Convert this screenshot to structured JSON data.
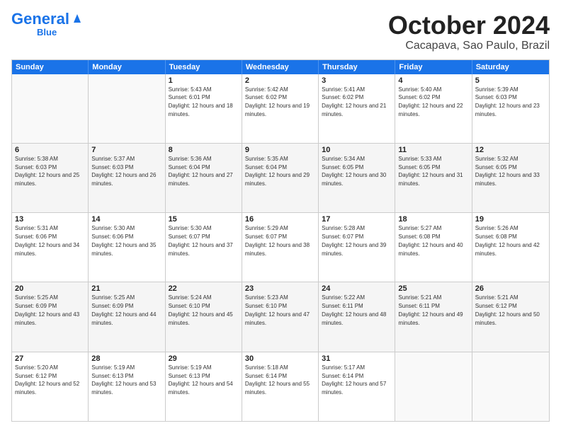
{
  "logo": {
    "part1": "General",
    "part2": "Blue"
  },
  "title": "October 2024",
  "subtitle": "Cacapava, Sao Paulo, Brazil",
  "days": [
    "Sunday",
    "Monday",
    "Tuesday",
    "Wednesday",
    "Thursday",
    "Friday",
    "Saturday"
  ],
  "weeks": [
    [
      {
        "day": "",
        "info": ""
      },
      {
        "day": "",
        "info": ""
      },
      {
        "day": "1",
        "info": "Sunrise: 5:43 AM\nSunset: 6:01 PM\nDaylight: 12 hours and 18 minutes."
      },
      {
        "day": "2",
        "info": "Sunrise: 5:42 AM\nSunset: 6:02 PM\nDaylight: 12 hours and 19 minutes."
      },
      {
        "day": "3",
        "info": "Sunrise: 5:41 AM\nSunset: 6:02 PM\nDaylight: 12 hours and 21 minutes."
      },
      {
        "day": "4",
        "info": "Sunrise: 5:40 AM\nSunset: 6:02 PM\nDaylight: 12 hours and 22 minutes."
      },
      {
        "day": "5",
        "info": "Sunrise: 5:39 AM\nSunset: 6:03 PM\nDaylight: 12 hours and 23 minutes."
      }
    ],
    [
      {
        "day": "6",
        "info": "Sunrise: 5:38 AM\nSunset: 6:03 PM\nDaylight: 12 hours and 25 minutes."
      },
      {
        "day": "7",
        "info": "Sunrise: 5:37 AM\nSunset: 6:03 PM\nDaylight: 12 hours and 26 minutes."
      },
      {
        "day": "8",
        "info": "Sunrise: 5:36 AM\nSunset: 6:04 PM\nDaylight: 12 hours and 27 minutes."
      },
      {
        "day": "9",
        "info": "Sunrise: 5:35 AM\nSunset: 6:04 PM\nDaylight: 12 hours and 29 minutes."
      },
      {
        "day": "10",
        "info": "Sunrise: 5:34 AM\nSunset: 6:05 PM\nDaylight: 12 hours and 30 minutes."
      },
      {
        "day": "11",
        "info": "Sunrise: 5:33 AM\nSunset: 6:05 PM\nDaylight: 12 hours and 31 minutes."
      },
      {
        "day": "12",
        "info": "Sunrise: 5:32 AM\nSunset: 6:05 PM\nDaylight: 12 hours and 33 minutes."
      }
    ],
    [
      {
        "day": "13",
        "info": "Sunrise: 5:31 AM\nSunset: 6:06 PM\nDaylight: 12 hours and 34 minutes."
      },
      {
        "day": "14",
        "info": "Sunrise: 5:30 AM\nSunset: 6:06 PM\nDaylight: 12 hours and 35 minutes."
      },
      {
        "day": "15",
        "info": "Sunrise: 5:30 AM\nSunset: 6:07 PM\nDaylight: 12 hours and 37 minutes."
      },
      {
        "day": "16",
        "info": "Sunrise: 5:29 AM\nSunset: 6:07 PM\nDaylight: 12 hours and 38 minutes."
      },
      {
        "day": "17",
        "info": "Sunrise: 5:28 AM\nSunset: 6:07 PM\nDaylight: 12 hours and 39 minutes."
      },
      {
        "day": "18",
        "info": "Sunrise: 5:27 AM\nSunset: 6:08 PM\nDaylight: 12 hours and 40 minutes."
      },
      {
        "day": "19",
        "info": "Sunrise: 5:26 AM\nSunset: 6:08 PM\nDaylight: 12 hours and 42 minutes."
      }
    ],
    [
      {
        "day": "20",
        "info": "Sunrise: 5:25 AM\nSunset: 6:09 PM\nDaylight: 12 hours and 43 minutes."
      },
      {
        "day": "21",
        "info": "Sunrise: 5:25 AM\nSunset: 6:09 PM\nDaylight: 12 hours and 44 minutes."
      },
      {
        "day": "22",
        "info": "Sunrise: 5:24 AM\nSunset: 6:10 PM\nDaylight: 12 hours and 45 minutes."
      },
      {
        "day": "23",
        "info": "Sunrise: 5:23 AM\nSunset: 6:10 PM\nDaylight: 12 hours and 47 minutes."
      },
      {
        "day": "24",
        "info": "Sunrise: 5:22 AM\nSunset: 6:11 PM\nDaylight: 12 hours and 48 minutes."
      },
      {
        "day": "25",
        "info": "Sunrise: 5:21 AM\nSunset: 6:11 PM\nDaylight: 12 hours and 49 minutes."
      },
      {
        "day": "26",
        "info": "Sunrise: 5:21 AM\nSunset: 6:12 PM\nDaylight: 12 hours and 50 minutes."
      }
    ],
    [
      {
        "day": "27",
        "info": "Sunrise: 5:20 AM\nSunset: 6:12 PM\nDaylight: 12 hours and 52 minutes."
      },
      {
        "day": "28",
        "info": "Sunrise: 5:19 AM\nSunset: 6:13 PM\nDaylight: 12 hours and 53 minutes."
      },
      {
        "day": "29",
        "info": "Sunrise: 5:19 AM\nSunset: 6:13 PM\nDaylight: 12 hours and 54 minutes."
      },
      {
        "day": "30",
        "info": "Sunrise: 5:18 AM\nSunset: 6:14 PM\nDaylight: 12 hours and 55 minutes."
      },
      {
        "day": "31",
        "info": "Sunrise: 5:17 AM\nSunset: 6:14 PM\nDaylight: 12 hours and 57 minutes."
      },
      {
        "day": "",
        "info": ""
      },
      {
        "day": "",
        "info": ""
      }
    ]
  ]
}
